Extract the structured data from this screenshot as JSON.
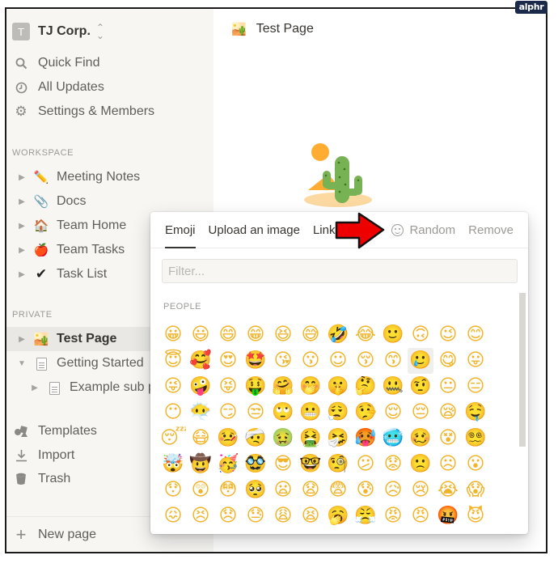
{
  "watermark": "alphr",
  "sidebar": {
    "workspace": {
      "avatar_letter": "T",
      "name": "TJ Corp.",
      "chevron": "⌃⌄"
    },
    "nav": [
      {
        "icon": "search-icon",
        "glyph": "⚲",
        "label": "Quick Find"
      },
      {
        "icon": "clock-icon",
        "glyph": "◷",
        "label": "All Updates"
      },
      {
        "icon": "gear-icon",
        "glyph": "⚙",
        "label": "Settings & Members"
      }
    ],
    "workspace_section": {
      "label": "WORKSPACE",
      "pages": [
        {
          "icon": "pencil-icon",
          "glyph": "✏️",
          "label": "Meeting Notes"
        },
        {
          "icon": "paperclip-icon",
          "glyph": "📎",
          "label": "Docs"
        },
        {
          "icon": "house-icon",
          "glyph": "🏠",
          "label": "Team Home"
        },
        {
          "icon": "apple-icon",
          "glyph": "🍎",
          "label": "Team Tasks"
        },
        {
          "icon": "checkmark-icon",
          "glyph": "✔",
          "label": "Task List"
        }
      ]
    },
    "private_section": {
      "label": "PRIVATE",
      "pages": [
        {
          "icon": "desert-icon",
          "glyph": "🏜️",
          "label": "Test Page",
          "active": true,
          "expanded": false
        },
        {
          "icon": "document-icon",
          "glyph": "",
          "label": "Getting Started",
          "expanded": true
        },
        {
          "icon": "document-icon",
          "glyph": "",
          "label": "Example sub page",
          "expanded": false
        }
      ]
    },
    "footer_nav": [
      {
        "icon": "templates-icon",
        "glyph": "⧉",
        "label": "Templates"
      },
      {
        "icon": "import-icon",
        "glyph": "⤓",
        "label": "Import"
      },
      {
        "icon": "trash-icon",
        "glyph": "🗑",
        "label": "Trash"
      }
    ],
    "new_page": {
      "glyph": "+",
      "label": "New page"
    }
  },
  "main": {
    "breadcrumb": {
      "icon": "🏜️",
      "title": "Test Page"
    },
    "page_icon": "desert"
  },
  "picker": {
    "tabs": [
      {
        "label": "Emoji",
        "active": true
      },
      {
        "label": "Upload an image",
        "active": false
      },
      {
        "label": "Link",
        "active": false
      }
    ],
    "random_label": "Random",
    "remove_label": "Remove",
    "filter_placeholder": "Filter...",
    "category": "PEOPLE",
    "emojis": [
      [
        "😀",
        "😃",
        "😄",
        "😁",
        "😆",
        "😅",
        "🤣",
        "😂",
        "🙂",
        "🙃",
        "😉",
        "😊"
      ],
      [
        "😇",
        "🥰",
        "😍",
        "🤩",
        "😘",
        "😗",
        "☺",
        "😚",
        "😙",
        "🥲",
        "😋",
        "😛"
      ],
      [
        "😜",
        "🤪",
        "😝",
        "🤑",
        "🤗",
        "🤭",
        "🤫",
        "🤔",
        "🤐",
        "🤨",
        "😐",
        "😑"
      ],
      [
        "😶",
        "😶‍🌫️",
        "😏",
        "😒",
        "🙄",
        "😬",
        "😮‍💨",
        "🤥",
        "😌",
        "😔",
        "😪",
        "🤤"
      ],
      [
        "😴",
        "😷",
        "🤒",
        "🤕",
        "🤢",
        "🤮",
        "🤧",
        "🥵",
        "🥶",
        "🥴",
        "😵",
        "😵‍💫"
      ],
      [
        "🤯",
        "🤠",
        "🥳",
        "🥸",
        "😎",
        "🤓",
        "🧐",
        "😕",
        "😟",
        "🙁",
        "☹",
        "😮"
      ],
      [
        "😯",
        "😲",
        "😳",
        "🥺",
        "😦",
        "😧",
        "😨",
        "😰",
        "😥",
        "😢",
        "😭",
        "😱"
      ],
      [
        "😖",
        "😣",
        "😞",
        "😓",
        "😩",
        "😫",
        "🥱",
        "😤",
        "😡",
        "😠",
        "🤬",
        "😈"
      ]
    ],
    "hovered": {
      "row": 1,
      "col": 9
    }
  },
  "annotation": {
    "type": "red-arrow",
    "points_to": "random-button",
    "color": "#ee0000"
  }
}
